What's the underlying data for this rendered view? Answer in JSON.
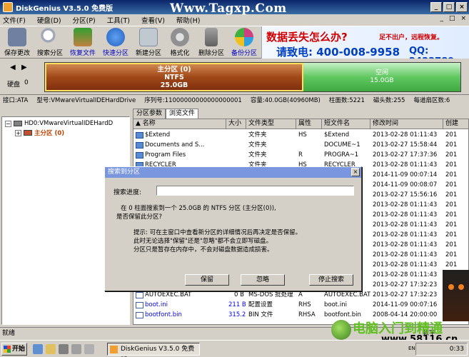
{
  "window": {
    "title": "DiskGenius V3.5.0 免费版",
    "watermark": "Www.Tagxp.Com",
    "buttons": [
      "_",
      "□",
      "×"
    ]
  },
  "menu": {
    "items": [
      "文件(F)",
      "硬盘(D)",
      "分区(P)",
      "工具(T)",
      "查看(V)",
      "帮助(H)"
    ],
    "right": [
      "_",
      "□",
      "×"
    ]
  },
  "toolbar": {
    "buttons": [
      {
        "label": "保存更改",
        "icon": "save-icon",
        "color": "#7080a0"
      },
      {
        "label": "搜索分区",
        "icon": "search-icon",
        "color": "#a0a8b8"
      },
      {
        "label": "恢复文件",
        "icon": "recover-icon",
        "color": "#308030"
      },
      {
        "label": "快速分区",
        "icon": "quick-partition-icon",
        "color": "#2060c0"
      },
      {
        "label": "新建分区",
        "icon": "new-partition-icon",
        "color": "#8090a0"
      },
      {
        "label": "格式化",
        "icon": "format-icon",
        "color": "#909090"
      },
      {
        "label": "删除分区",
        "icon": "delete-icon",
        "color": "#808080"
      },
      {
        "label": "备份分区",
        "icon": "backup-icon",
        "color": "#d04080"
      }
    ],
    "ad": {
      "line1": "数据丢失怎么办?",
      "line1b": "足不出户，远程恢复。",
      "line2": "请致电: 400-008-9958",
      "line2b": "QQ: 2433789"
    }
  },
  "diskbar": {
    "disk_label": "硬盘",
    "disk_number": "0",
    "main_partition": {
      "name": "主分区 (0)",
      "fs": "NTFS",
      "size": "25.0GB"
    },
    "free": {
      "name": "空闲",
      "size": "15.0GB"
    }
  },
  "info": {
    "items": [
      "接口:ATA",
      "型号:VMwareVirtualIDEHardDrive",
      "序列号:11000000000000000001",
      "容量:40.0GB(40960MB)",
      "柱面数:5221",
      "磁头数:255",
      "每道扇区数:6"
    ]
  },
  "tree": {
    "disk": "HD0:VMwareVirtualIDEHardD",
    "partition": "主分区 (0)"
  },
  "tabs": [
    "分区参数",
    "浏览文件"
  ],
  "table": {
    "headers": [
      "名称",
      "大小",
      "文件类型",
      "属性",
      "短文件名",
      "修改时间",
      "创建"
    ],
    "rows": [
      {
        "name": "$Extend",
        "size": "",
        "type": "文件夹",
        "attr": "HS",
        "short": "$Extend",
        "time": "2013-02-28 01:11:43",
        "create": "201",
        "icon": "folder",
        "blue": false
      },
      {
        "name": "Documents and S...",
        "size": "",
        "type": "文件夹",
        "attr": "",
        "short": "DOCUME~1",
        "time": "2013-02-27 15:58:44",
        "create": "201",
        "icon": "folder",
        "blue": false
      },
      {
        "name": "Program Files",
        "size": "",
        "type": "文件夹",
        "attr": "R",
        "short": "PROGRA~1",
        "time": "2013-02-27 17:37:36",
        "create": "201",
        "icon": "folder",
        "blue": false
      },
      {
        "name": "RECYCLER",
        "size": "",
        "type": "文件夹",
        "attr": "HS",
        "short": "RECYCLER",
        "time": "2013-02-28 01:11:43",
        "create": "201",
        "icon": "folder",
        "blue": false
      },
      {
        "name": "",
        "size": "",
        "type": "",
        "attr": "",
        "short": "",
        "time": "2014-11-09 00:07:14",
        "create": "201",
        "icon": "none",
        "blue": false
      },
      {
        "name": "",
        "size": "",
        "type": "",
        "attr": "",
        "short": "",
        "time": "2014-11-09 00:08:07",
        "create": "201",
        "icon": "none",
        "blue": false
      },
      {
        "name": "",
        "size": "",
        "type": "",
        "attr": "",
        "short": "",
        "time": "2013-02-27 15:56:16",
        "create": "201",
        "icon": "none",
        "blue": false
      },
      {
        "name": "",
        "size": "",
        "type": "",
        "attr": "",
        "short": "",
        "time": "2013-02-28 01:11:43",
        "create": "201",
        "icon": "none",
        "blue": false
      },
      {
        "name": "",
        "size": "",
        "type": "",
        "attr": "",
        "short": "",
        "time": "2013-02-28 01:11:43",
        "create": "201",
        "icon": "none",
        "blue": false
      },
      {
        "name": "",
        "size": "",
        "type": "",
        "attr": "",
        "short": "",
        "time": "2013-02-28 01:11:43",
        "create": "201",
        "icon": "none",
        "blue": false
      },
      {
        "name": "",
        "size": "",
        "type": "",
        "attr": "",
        "short": "",
        "time": "2013-02-28 01:11:43",
        "create": "201",
        "icon": "none",
        "blue": false
      },
      {
        "name": "",
        "size": "",
        "type": "",
        "attr": "",
        "short": "",
        "time": "2013-02-28 01:11:43",
        "create": "201",
        "icon": "none",
        "blue": false
      },
      {
        "name": "",
        "size": "",
        "type": "",
        "attr": "",
        "short": "",
        "time": "2013-02-28 01:11:43",
        "create": "201",
        "icon": "none",
        "blue": false
      },
      {
        "name": "",
        "size": "",
        "type": "",
        "attr": "",
        "short": "",
        "time": "2013-02-28 01:11:43",
        "create": "201",
        "icon": "none",
        "blue": false
      },
      {
        "name": "",
        "size": "",
        "type": "",
        "attr": "",
        "short": "",
        "time": "2013-02-28 01:11:43",
        "create": "201",
        "icon": "none",
        "blue": false
      },
      {
        "name": "",
        "size": "",
        "type": "",
        "attr": "",
        "short": "",
        "time": "2013-02-27 17:32:23",
        "create": "201",
        "icon": "none",
        "blue": false
      },
      {
        "name": "AUTOEXEC.BAT",
        "size": "0 B",
        "type": "MS-DOS 批处理",
        "attr": "A",
        "short": "AUTOEXEC.BAT",
        "time": "2013-02-27 17:32:23",
        "create": "201",
        "icon": "doc",
        "blue": false
      },
      {
        "name": "boot.ini",
        "size": "211 B",
        "type": "配置设置",
        "attr": "RHS",
        "short": "boot.ini",
        "time": "2014-11-09 00:07:16",
        "create": "201",
        "icon": "doc",
        "blue": true
      },
      {
        "name": "bootfont.bin",
        "size": "315.2KB",
        "type": "BIN 文件",
        "attr": "RHSA",
        "short": "bootfont.bin",
        "time": "2008-04-14 20:00:00",
        "create": "201",
        "icon": "doc",
        "blue": true
      }
    ]
  },
  "dialog": {
    "title": "搜索到分区",
    "close": "×",
    "progress_label": "搜索进度:",
    "progress_fraction": 0,
    "msg1": "在 0 柱面搜索到一个 25.0GB 的 NTFS 分区 (主分区(0)),",
    "msg2": "是否保留此分区?",
    "tip1": "提示: 可在主窗口中查看新分区的详细情况后再决定是否保留。",
    "tip2": "此时无论选择\"保留\"还是\"忽略\"都不会立即写磁盘。",
    "tip3": "分区只是暂存在内存中，不会对磁盘数据造成损害。",
    "buttons": {
      "keep": "保留",
      "ignore": "忽略",
      "stop": "停止搜索"
    }
  },
  "status": {
    "text": "就绪",
    "num": "数字"
  },
  "taskbar": {
    "start": "开始",
    "task": "DiskGenius V3.5.0 免费版",
    "lang": "EN",
    "clock": "0:33"
  },
  "watermark2": {
    "big": "电脑入门到精通",
    "url": "www.58116.cn"
  }
}
